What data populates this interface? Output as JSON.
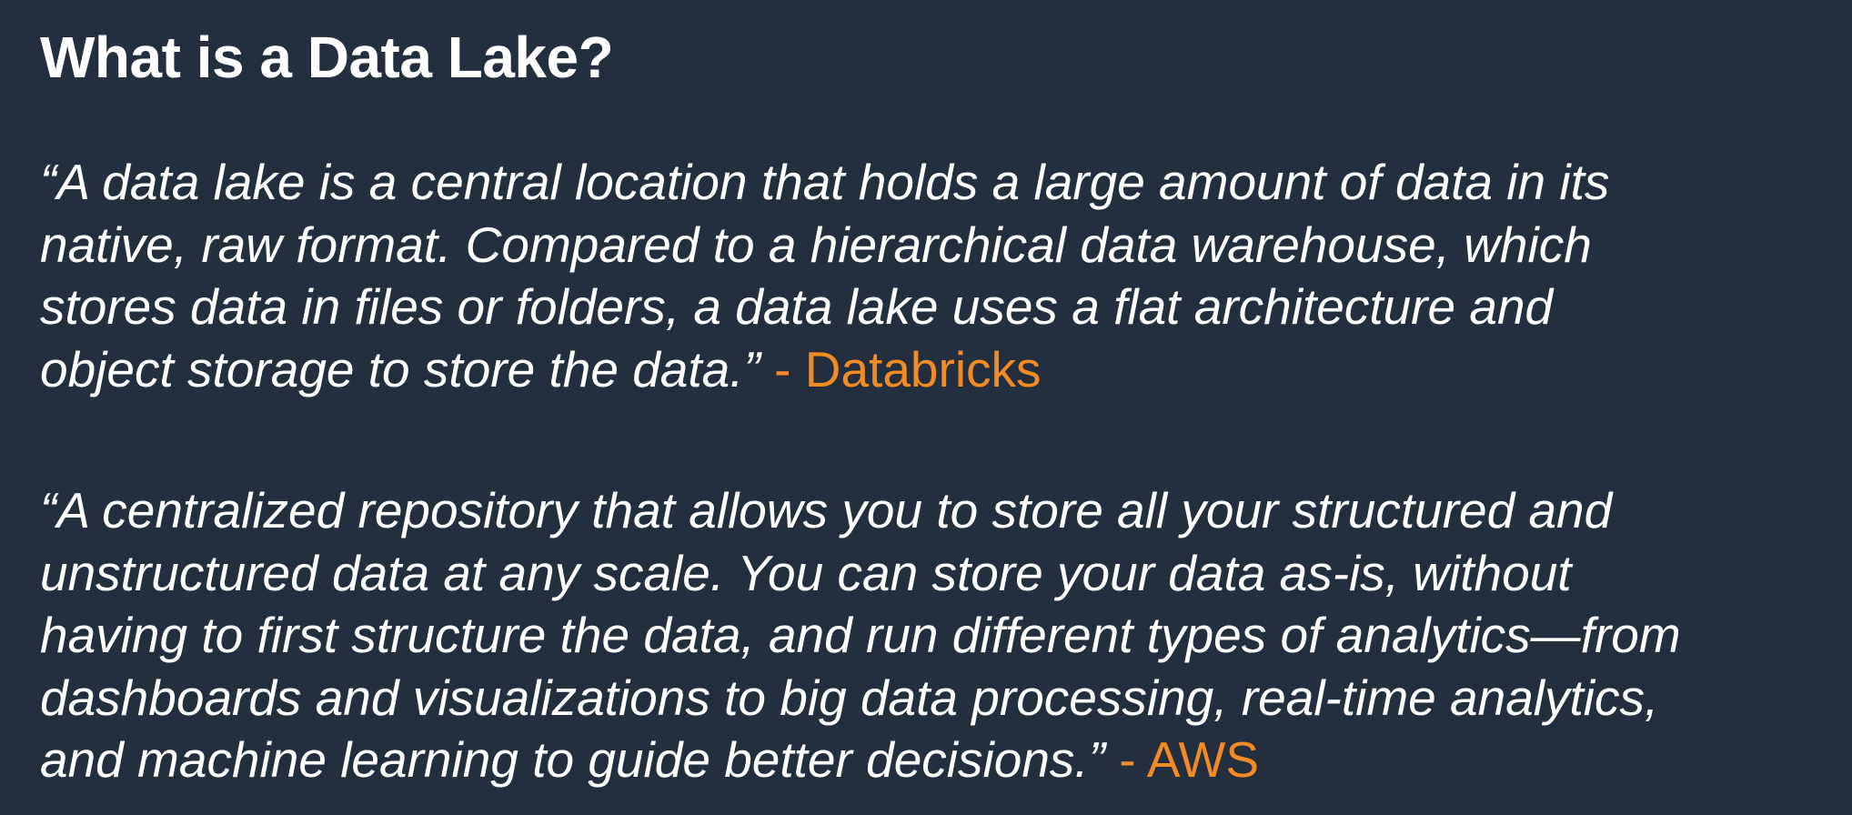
{
  "slide": {
    "title": "What is a Data Lake?",
    "accent_color": "#f28b24",
    "background_color": "#232f3e",
    "quotes": [
      {
        "lines": [
          "“A data lake is a central location that holds a large amount of data in its",
          "native, raw format. Compared to a hierarchical data warehouse, which",
          "stores data in files or folders, a data lake uses a flat architecture and",
          "object storage to store the data.”"
        ],
        "attribution": "- Databricks"
      },
      {
        "lines": [
          "“A centralized repository that allows you to store all your structured and",
          "unstructured data at any scale. You can store your data as-is, without",
          "having to first structure the data, and run different types of analytics—from",
          "dashboards and visualizations to big data processing, real-time analytics,",
          "and machine learning to guide better decisions.”"
        ],
        "attribution": "- AWS"
      }
    ]
  }
}
